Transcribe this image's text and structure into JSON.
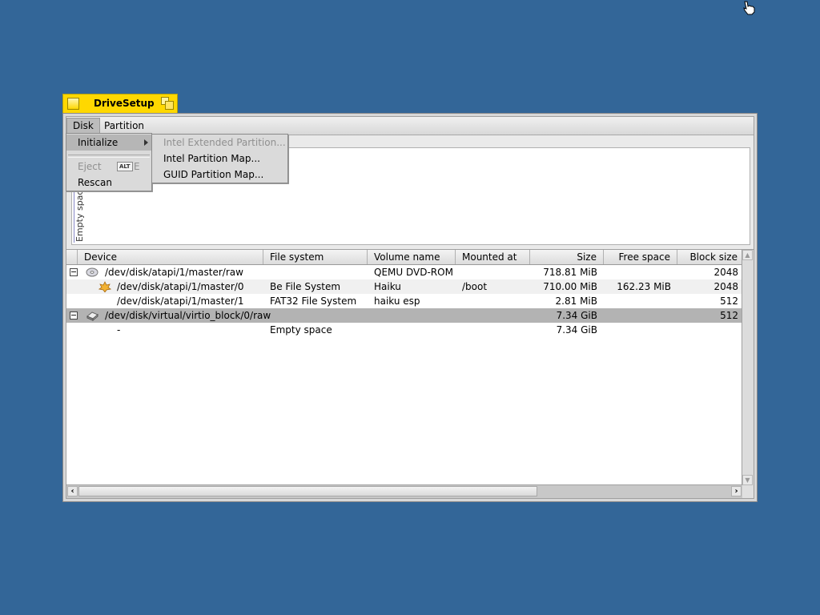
{
  "window": {
    "title": "DriveSetup",
    "accent_color": "#ffd800",
    "desktop_color": "#336698"
  },
  "menubar": {
    "items": [
      {
        "label": "Disk",
        "active": true
      },
      {
        "label": "Partition",
        "active": false
      }
    ]
  },
  "disk_menu": {
    "items": [
      {
        "label": "Initialize",
        "highlighted": true,
        "submenu": true
      },
      {
        "label": "Eject",
        "disabled": true,
        "shortcut_modifier": "ALT",
        "shortcut_key": "E"
      },
      {
        "label": "Rescan",
        "disabled": false
      }
    ]
  },
  "initialize_submenu": {
    "items": [
      {
        "label": "Intel Extended Partition...",
        "disabled": true
      },
      {
        "label": "Intel Partition Map...",
        "disabled": false
      },
      {
        "label": "GUID Partition Map...",
        "disabled": false
      }
    ]
  },
  "disk_map": {
    "segment_label": "Empty space"
  },
  "table": {
    "columns": [
      "Device",
      "File system",
      "Volume name",
      "Mounted at",
      "Size",
      "Free space",
      "Block size"
    ],
    "rows": [
      {
        "device": "/dev/disk/atapi/1/master/raw",
        "icon": "cd-icon",
        "expander": true,
        "indent": 0,
        "file_system": "",
        "volume_name": "QEMU DVD-ROM",
        "mounted_at": "",
        "size": "718.81 MiB",
        "free_space": "",
        "block_size": "2048"
      },
      {
        "device": "/dev/disk/atapi/1/master/0",
        "icon": "haiku-leaf-icon",
        "expander": false,
        "indent": 1,
        "file_system": "Be File System",
        "volume_name": "Haiku",
        "mounted_at": "/boot",
        "size": "710.00 MiB",
        "free_space": "162.23 MiB",
        "block_size": "2048"
      },
      {
        "device": "/dev/disk/atapi/1/master/1",
        "icon": "",
        "expander": false,
        "indent": 1,
        "file_system": "FAT32 File System",
        "volume_name": "haiku esp",
        "mounted_at": "",
        "size": "2.81 MiB",
        "free_space": "",
        "block_size": "512"
      },
      {
        "device": "/dev/disk/virtual/virtio_block/0/raw",
        "icon": "harddisk-icon",
        "expander": true,
        "indent": 0,
        "selected": true,
        "file_system": "",
        "volume_name": "",
        "mounted_at": "",
        "size": "7.34 GiB",
        "free_space": "",
        "block_size": "512"
      },
      {
        "device": "-",
        "icon": "",
        "expander": false,
        "indent": 1,
        "file_system": "Empty space",
        "volume_name": "",
        "mounted_at": "",
        "size": "7.34 GiB",
        "free_space": "",
        "block_size": ""
      }
    ]
  }
}
